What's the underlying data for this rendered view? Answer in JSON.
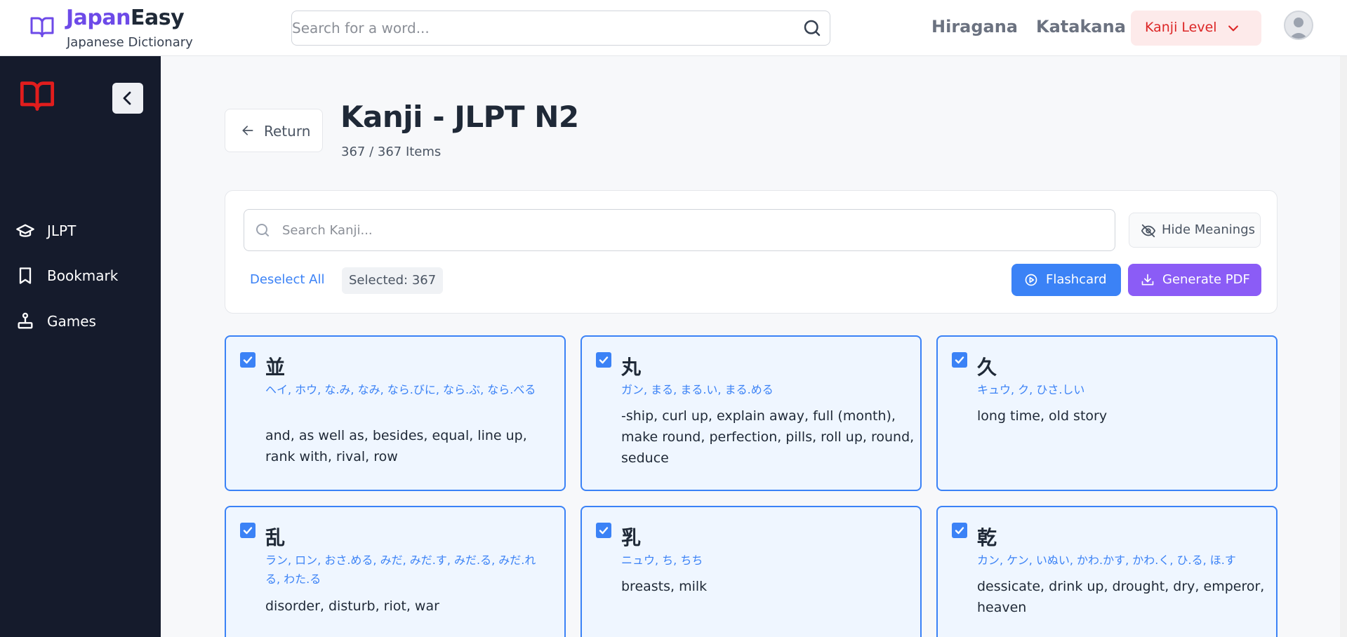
{
  "header": {
    "brand_part1": "Japan",
    "brand_part2": "Easy",
    "brand_sub": "Japanese Dictionary",
    "search_placeholder": "Search for a word...",
    "nav_hiragana": "Hiragana",
    "nav_katakana": "Katakana",
    "level_label": "Kanji Level"
  },
  "sidebar": {
    "items": [
      {
        "label": "JLPT",
        "icon": "graduation-cap-icon"
      },
      {
        "label": "Bookmark",
        "icon": "bookmark-icon"
      },
      {
        "label": "Games",
        "icon": "joystick-icon"
      }
    ]
  },
  "main": {
    "return_label": "Return",
    "title": "Kanji - JLPT N2",
    "count": "367 / 367 Items",
    "search_placeholder": "Search Kanji...",
    "hide_meanings": "Hide Meanings",
    "deselect_all": "Deselect All",
    "selected": "Selected: 367",
    "flashcard": "Flashcard",
    "generate_pdf": "Generate PDF"
  },
  "colors": {
    "brand": "#6d4ae8",
    "accent_blue": "#3b82f6",
    "accent_purple": "#8b5cf6",
    "danger": "#dc2626",
    "sidebar_bg": "#151b2c"
  },
  "cards": [
    {
      "kanji": "並",
      "reading": "ヘイ, ホウ, な.み, なみ, なら.びに, なら.ぶ, なら.べる",
      "meaning": "and, as well as, besides, equal, line up, rank with, rival, row",
      "checked": true
    },
    {
      "kanji": "丸",
      "reading": "ガン, まる, まる.い, まる.める",
      "meaning": "-ship, curl up, explain away, full (month), make round, perfection, pills, roll up, round, seduce",
      "checked": true
    },
    {
      "kanji": "久",
      "reading": "キュウ, ク, ひさ.しい",
      "meaning": "long time, old story",
      "checked": true
    },
    {
      "kanji": "乱",
      "reading": "ラン, ロン, おさ.める, みだ, みだ.す, みだ.る, みだ.れる, わた.る",
      "meaning": "disorder, disturb, riot, war",
      "checked": true
    },
    {
      "kanji": "乳",
      "reading": "ニュウ, ち, ちち",
      "meaning": "breasts, milk",
      "checked": true
    },
    {
      "kanji": "乾",
      "reading": "カン, ケン, いぬい, かわ.かす, かわ.く, ひ.る, ほ.す",
      "meaning": "dessicate, drink up, drought, dry, emperor, heaven",
      "checked": true
    }
  ]
}
